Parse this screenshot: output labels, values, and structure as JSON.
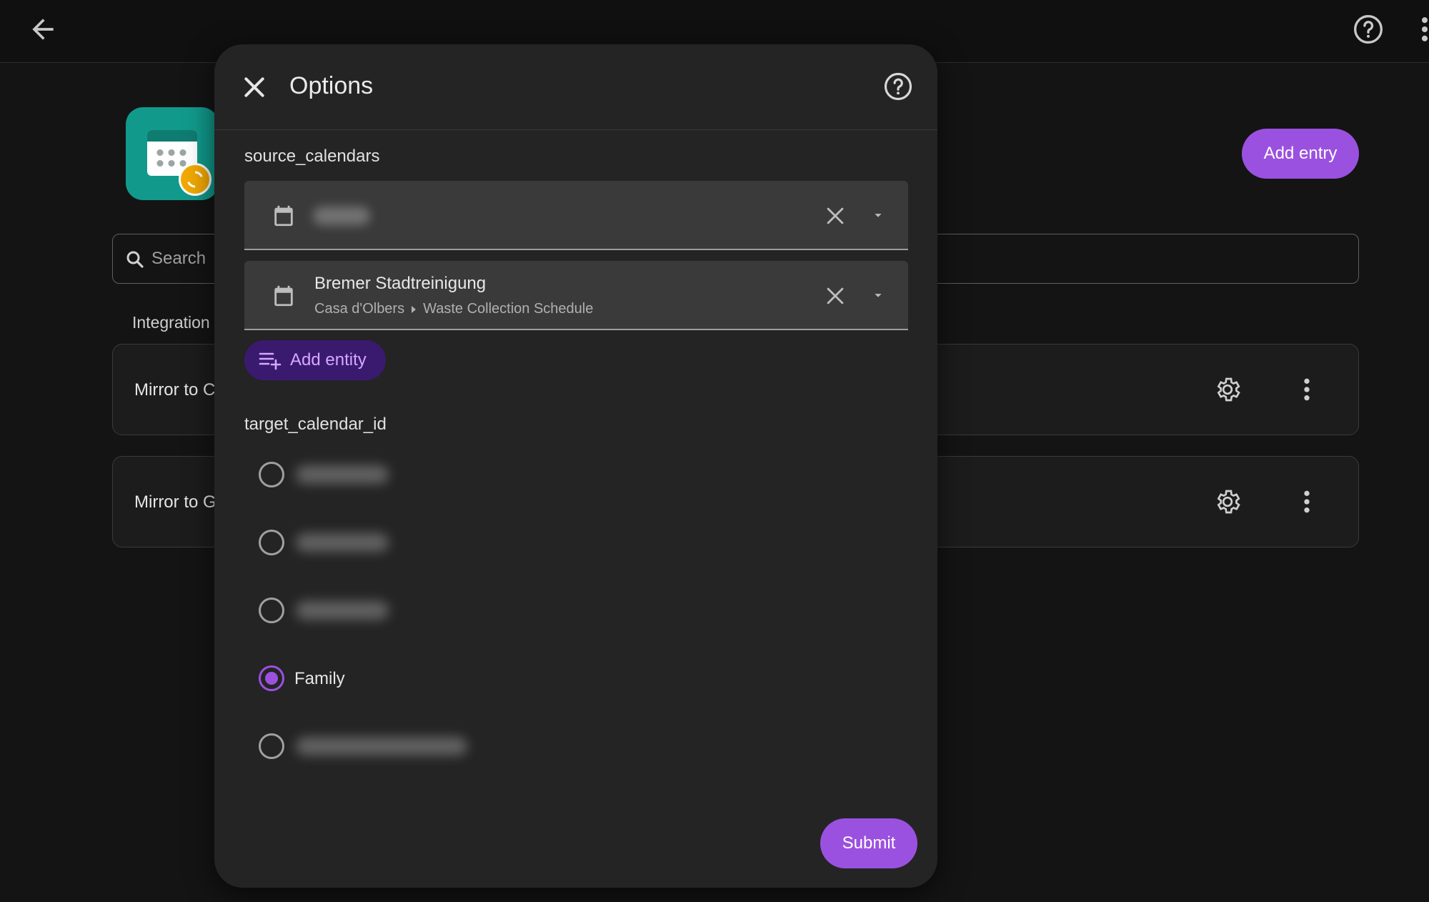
{
  "background": {
    "add_entry_label": "Add entry",
    "search_placeholder": "Search",
    "section_label": "Integration",
    "rows": [
      {
        "title": "Mirror to C"
      },
      {
        "title": "Mirror to G"
      }
    ]
  },
  "dialog": {
    "title": "Options",
    "source_label": "source_calendars",
    "pickers": [
      {
        "name": "",
        "blurred": true
      },
      {
        "name": "Bremer Stadtreinigung",
        "area": "Casa d'Olbers",
        "device": "Waste Collection Schedule"
      }
    ],
    "add_entity_label": "Add entity",
    "target_label": "target_calendar_id",
    "radio_options": [
      {
        "label": "",
        "blurred": true,
        "selected": false
      },
      {
        "label": "",
        "blurred": true,
        "selected": false
      },
      {
        "label": "",
        "blurred": true,
        "selected": false
      },
      {
        "label": "Family",
        "blurred": false,
        "selected": true
      },
      {
        "label": "",
        "blurred": true,
        "selected": false
      }
    ],
    "submit_label": "Submit"
  },
  "icons": {
    "back": "arrow-left-icon",
    "help": "help-circle-icon",
    "more": "dots-vertical-icon",
    "close": "close-icon",
    "calendar": "calendar-icon",
    "clear": "clear-icon",
    "dropdown": "menu-down-icon",
    "search": "magnify-icon",
    "settings": "cog-icon",
    "add_entity": "playlist-plus-icon"
  },
  "colors": {
    "accent": "#9b51e0",
    "app_icon": "#119a8c",
    "dialog_bg": "#242424"
  }
}
